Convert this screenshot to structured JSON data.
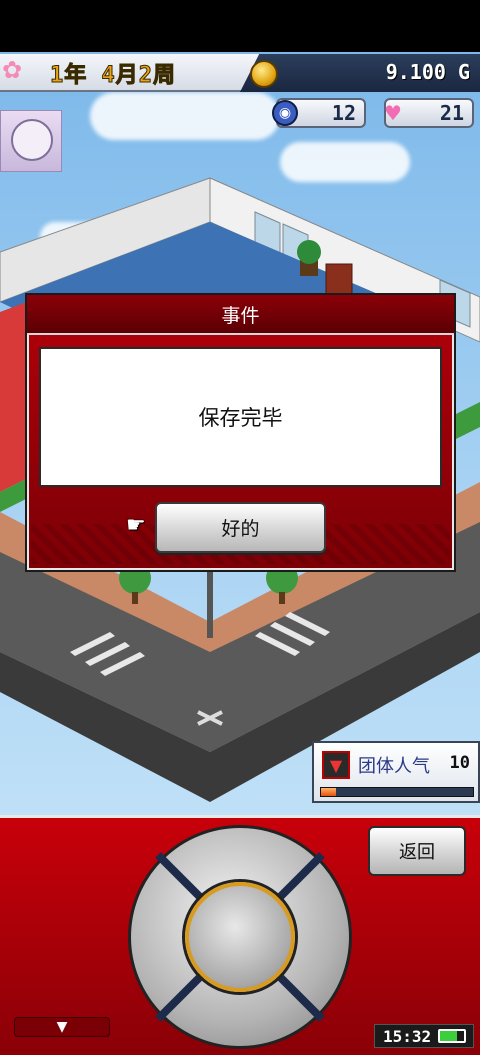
{
  "hud": {
    "year": "1年",
    "month_week": "4月2周",
    "money": "9.100 G",
    "stat_blue_value": "12",
    "stat_heart_value": "21"
  },
  "dialog": {
    "title": "事件",
    "message": "保存完毕",
    "ok_label": "好的"
  },
  "popularity": {
    "label": "团体人气",
    "value": "10",
    "progress_percent": 10
  },
  "controls": {
    "back_label": "返回",
    "menu_arrow": "▼"
  },
  "clock": {
    "time": "15:32"
  },
  "colors": {
    "accent_red": "#b3000a",
    "gold": "#e2a512"
  }
}
